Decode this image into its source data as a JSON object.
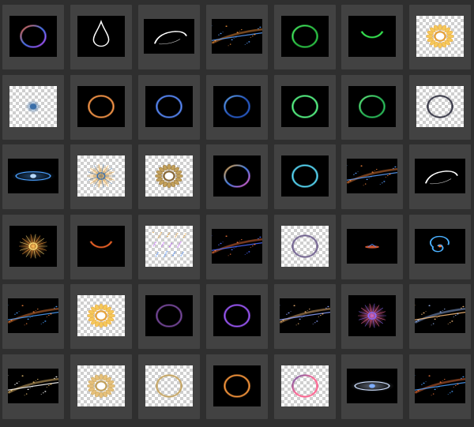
{
  "browser": {
    "columns": 7,
    "rows": 6,
    "items": [
      {
        "id": "r1c1",
        "kind": "ring",
        "bg": "dark",
        "colors": [
          "#ff6a3d",
          "#4a7bff",
          "#c04bff"
        ]
      },
      {
        "id": "r1c2",
        "kind": "drop",
        "bg": "dark",
        "colors": [
          "#ffffff"
        ]
      },
      {
        "id": "r1c3",
        "kind": "swoosh",
        "bg": "dark",
        "colors": [
          "#ffffff"
        ]
      },
      {
        "id": "r1c4",
        "kind": "streak",
        "bg": "dark",
        "colors": [
          "#ff9a3d",
          "#5aa0ff"
        ]
      },
      {
        "id": "r1c5",
        "kind": "ring",
        "bg": "dark",
        "colors": [
          "#4dff6a",
          "#2fd14a"
        ]
      },
      {
        "id": "r1c6",
        "kind": "arc",
        "bg": "dark",
        "colors": [
          "#3dff5a"
        ]
      },
      {
        "id": "r1c7",
        "kind": "flower",
        "bg": "checker",
        "colors": [
          "#e6a23c",
          "#f5c85a"
        ]
      },
      {
        "id": "r2c1",
        "kind": "orb",
        "bg": "checker",
        "colors": [
          "#3a6ea8"
        ]
      },
      {
        "id": "r2c2",
        "kind": "ring",
        "bg": "dark",
        "colors": [
          "#ff9a4a"
        ]
      },
      {
        "id": "r2c3",
        "kind": "ring",
        "bg": "dark",
        "colors": [
          "#5a8cff"
        ]
      },
      {
        "id": "r2c4",
        "kind": "ring",
        "bg": "dark",
        "colors": [
          "#6ab0ff",
          "#2a5fd0"
        ]
      },
      {
        "id": "r2c5",
        "kind": "ring",
        "bg": "dark",
        "colors": [
          "#5aff8a"
        ]
      },
      {
        "id": "r2c6",
        "kind": "ring",
        "bg": "dark",
        "colors": [
          "#6aff8a",
          "#2ec860"
        ]
      },
      {
        "id": "r2c7",
        "kind": "ring",
        "bg": "checker",
        "colors": [
          "#2a2a3a"
        ]
      },
      {
        "id": "r3c1",
        "kind": "eye",
        "bg": "dark",
        "colors": [
          "#4aa0ff",
          "#ffffff"
        ]
      },
      {
        "id": "r3c2",
        "kind": "burst",
        "bg": "checker",
        "colors": [
          "#e6a23c",
          "#3a6ea8"
        ]
      },
      {
        "id": "r3c3",
        "kind": "flower",
        "bg": "checker",
        "colors": [
          "#8a6a3a",
          "#c2a05a"
        ]
      },
      {
        "id": "r3c4",
        "kind": "ring",
        "bg": "dark",
        "colors": [
          "#ffb03d",
          "#4a8cff",
          "#ff5ad0"
        ]
      },
      {
        "id": "r3c5",
        "kind": "ring",
        "bg": "dark",
        "colors": [
          "#5ae0ff"
        ]
      },
      {
        "id": "r3c6",
        "kind": "streak",
        "bg": "dark",
        "colors": [
          "#ff8a3d",
          "#5aa0ff"
        ]
      },
      {
        "id": "r3c7",
        "kind": "swoosh",
        "bg": "dark",
        "colors": [
          "#ffffff"
        ]
      },
      {
        "id": "r4c1",
        "kind": "burst",
        "bg": "dark",
        "colors": [
          "#ffa03d",
          "#ffe07a"
        ]
      },
      {
        "id": "r4c2",
        "kind": "arc",
        "bg": "dark",
        "colors": [
          "#ff6a2a"
        ]
      },
      {
        "id": "r4c3",
        "kind": "confetti",
        "bg": "checker",
        "colors": [
          "#e6a23c",
          "#4a8cff",
          "#c05aff"
        ]
      },
      {
        "id": "r4c4",
        "kind": "streak",
        "bg": "dark",
        "colors": [
          "#ff7a3d",
          "#4a6aff",
          "#c04bff"
        ]
      },
      {
        "id": "r4c5",
        "kind": "ring",
        "bg": "checker",
        "colors": [
          "#6a5a8a"
        ]
      },
      {
        "id": "r4c6",
        "kind": "spark",
        "bg": "dark",
        "colors": [
          "#ff6a3d",
          "#4a8cff"
        ]
      },
      {
        "id": "r4c7",
        "kind": "spiral",
        "bg": "dark",
        "colors": [
          "#4ab0ff",
          "#ff7a3d"
        ]
      },
      {
        "id": "r5c1",
        "kind": "streak",
        "bg": "dark",
        "colors": [
          "#ff8a3d",
          "#4aa0ff"
        ]
      },
      {
        "id": "r5c2",
        "kind": "flower",
        "bg": "checker",
        "colors": [
          "#e6a23c",
          "#f5c85a"
        ]
      },
      {
        "id": "r5c3",
        "kind": "ring",
        "bg": "dark",
        "colors": [
          "#7a4aa0"
        ]
      },
      {
        "id": "r5c4",
        "kind": "ring",
        "bg": "dark",
        "colors": [
          "#a05aff"
        ]
      },
      {
        "id": "r5c5",
        "kind": "streak",
        "bg": "dark",
        "colors": [
          "#ffc07a",
          "#8aa0ff"
        ]
      },
      {
        "id": "r5c6",
        "kind": "burst",
        "bg": "dark",
        "colors": [
          "#ff6aa0",
          "#8a6aff"
        ]
      },
      {
        "id": "r5c7",
        "kind": "streak",
        "bg": "dark",
        "colors": [
          "#a0c0ff",
          "#ffc07a"
        ]
      },
      {
        "id": "r6c1",
        "kind": "streak",
        "bg": "dark",
        "colors": [
          "#ffd07a",
          "#ffffff"
        ]
      },
      {
        "id": "r6c2",
        "kind": "flower",
        "bg": "checker",
        "colors": [
          "#c2a05a",
          "#e6c07a"
        ]
      },
      {
        "id": "r6c3",
        "kind": "ring",
        "bg": "checker",
        "colors": [
          "#c2a05a"
        ]
      },
      {
        "id": "r6c4",
        "kind": "ring",
        "bg": "dark",
        "colors": [
          "#ff9a3d"
        ]
      },
      {
        "id": "r6c5",
        "kind": "ring",
        "bg": "checker",
        "colors": [
          "#5a4aa0",
          "#ff5a8a"
        ]
      },
      {
        "id": "r6c6",
        "kind": "eye",
        "bg": "dark",
        "colors": [
          "#cfe0ff",
          "#4a8cff"
        ]
      },
      {
        "id": "r6c7",
        "kind": "streak",
        "bg": "dark",
        "colors": [
          "#ff7a3d",
          "#4aa0ff"
        ]
      }
    ]
  }
}
